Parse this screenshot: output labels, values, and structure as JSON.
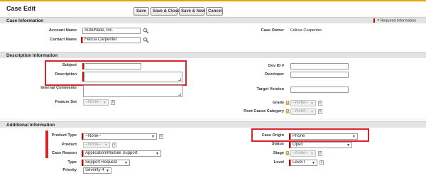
{
  "header": {
    "title": "Case Edit",
    "buttons": [
      "Save",
      "Save & Close",
      "Save & New",
      "Cancel"
    ]
  },
  "case_information": {
    "section_title": "Case Information",
    "required_legend": "= Required Information",
    "account_name_label": "Account Name",
    "account_name_value": "Auto/Mate, Inc.",
    "contact_name_label": "Contact Name",
    "contact_name_value": "Felicia Carpenter",
    "case_owner_label": "Case Owner",
    "case_owner_value": "Felicia Carpenter",
    "lookup_icon": "magnifier-lookup-icon"
  },
  "description_information": {
    "section_title": "Description Information",
    "subject_label": "Subject",
    "subject_value": "",
    "description_label": "Description",
    "description_value": "",
    "internal_comments_label": "Internal Comments",
    "internal_comments_value": "",
    "feature_set_label": "Feature Set",
    "feature_set_value": "--None--",
    "dev_id_label": "Dev ID #",
    "dev_id_value": "",
    "developer_label": "Developer",
    "developer_value": "",
    "target_version_label": "Target Version",
    "target_version_value": "",
    "grade_label": "Grade",
    "grade_value": "--None--",
    "root_cause_label": "Root Cause Category",
    "root_cause_value": "--None--"
  },
  "additional_information": {
    "section_title": "Additional Information",
    "product_type_label": "Product Type",
    "product_type_value": "--None--",
    "product_label": "Product",
    "product_value": "--None--",
    "case_reason_label": "Case Reason",
    "case_reason_value": "Application/Module Support",
    "type_label": "Type",
    "type_value": "Support Request",
    "priority_label": "Priority",
    "priority_value": "Severity 4",
    "case_origin_label": "Case Origin",
    "case_origin_value": "Phone",
    "status_label": "Status",
    "status_value": "Open",
    "stage_label": "Stage",
    "stage_value": "--None--",
    "level_label": "Level",
    "level_value": "Level I"
  },
  "colors": {
    "required": "#cc0000",
    "highlight": "#d9232d",
    "section_bg": "#e3e3e3",
    "accent": "#e8a200"
  }
}
